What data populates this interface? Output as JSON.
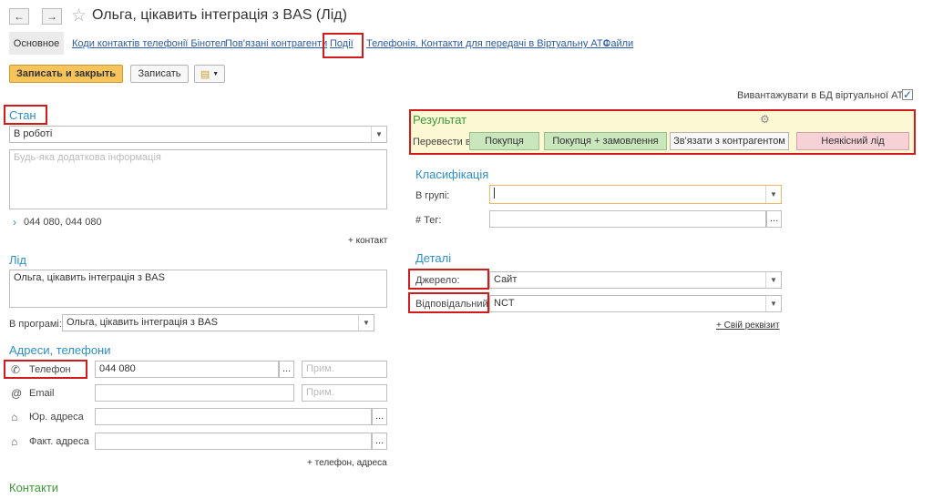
{
  "window": {
    "title": "Ольга, цікавить інтеграція з BAS (Лід)"
  },
  "tabs": {
    "main": "Основное",
    "items": [
      "Коди контактів телефонії Бінотел",
      "Пов'язані контрагенти",
      "Події",
      "Телефонія. Контакти для передачі в Віртуальну АТС",
      "Файли"
    ]
  },
  "toolbar": {
    "save_close": "Записать и закрыть",
    "save": "Записать"
  },
  "upload": {
    "label": "Вивантажувати в БД віртуальної АТС:",
    "checked": true
  },
  "state": {
    "title": "Стан",
    "value": "В роботі",
    "note_placeholder": "Будь-яка додаткова інформація",
    "phones": "044        080, 044        080",
    "add_contact": "+ контакт"
  },
  "lead": {
    "title": "Лід",
    "text": "Ольга, цікавить інтеграція з BAS",
    "program_label": "В програмі:",
    "program_value": "Ольга, цікавить інтеграція з BAS"
  },
  "addresses": {
    "title": "Адреси, телефони",
    "phone_label": "Телефон",
    "phone_value": "044        080",
    "email_label": "Email",
    "legal_label": "Юр. адреса",
    "actual_label": "Факт. адреса",
    "note_placeholder": "Прим.",
    "add_link": "+ телефон, адреса"
  },
  "contacts": {
    "title": "Контакти"
  },
  "result": {
    "title": "Результат",
    "convert_label": "Перевести в:",
    "buttons": [
      "Покупця",
      "Покупця + замовлення",
      "Зв'язати з контрагентом",
      "Неякісний лід"
    ]
  },
  "classification": {
    "title": "Класифікація",
    "group_label": "В групі:",
    "tag_label": "# Тег:"
  },
  "details": {
    "title": "Деталі",
    "source_label": "Джерело:",
    "source_value": "Сайт",
    "responsible_label": "Відповідальний:",
    "responsible_value": "NCT",
    "own_attr": "+ Свій реквізит"
  },
  "colors": {
    "accent_blue": "#2d8fc7",
    "green_heading": "#3b9a38",
    "highlight_red": "#d11a1a",
    "result_bg": "#fdf8d4",
    "primary_button": "#f6c45a"
  }
}
